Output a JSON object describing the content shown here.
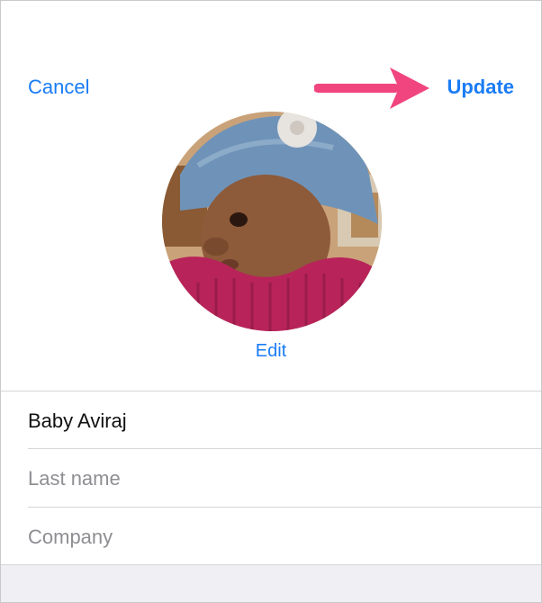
{
  "nav": {
    "cancel_label": "Cancel",
    "update_label": "Update"
  },
  "photo": {
    "edit_label": "Edit"
  },
  "form": {
    "first_name_value": "Baby Aviraj",
    "last_name_placeholder": "Last name",
    "company_placeholder": "Company"
  },
  "colors": {
    "accent": "#1a7cf5",
    "annotation_arrow": "#f0457f",
    "separator": "#d5d5d9",
    "bottom_background": "#efeff4"
  }
}
